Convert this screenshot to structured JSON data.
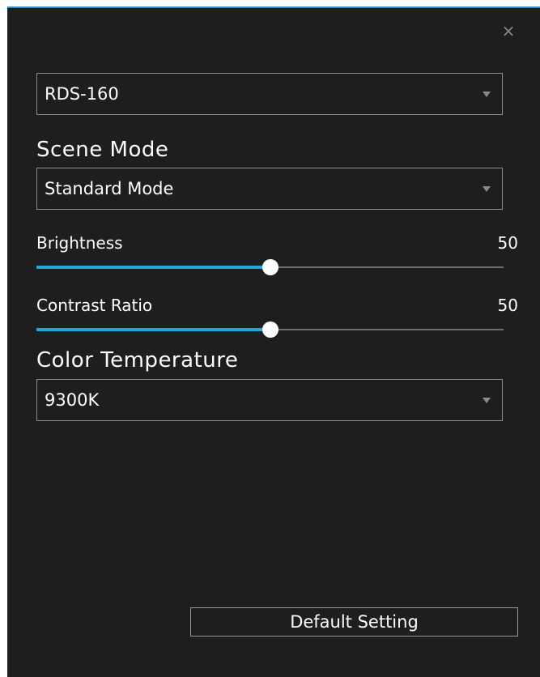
{
  "close": {
    "glyph": "×"
  },
  "device": {
    "selected": "RDS-160"
  },
  "scene_mode": {
    "label": "Scene Mode",
    "selected": "Standard Mode"
  },
  "brightness": {
    "label": "Brightness",
    "value": "50",
    "fraction": 0.5
  },
  "contrast": {
    "label": "Contrast Ratio",
    "value": "50",
    "fraction": 0.5
  },
  "color_temperature": {
    "label": "Color Temperature",
    "selected": "9300K"
  },
  "default_button": {
    "label": "Default Setting"
  },
  "colors": {
    "accent": "#1fa8d8",
    "background": "#1e1e20",
    "border": "#8e8e8e"
  }
}
